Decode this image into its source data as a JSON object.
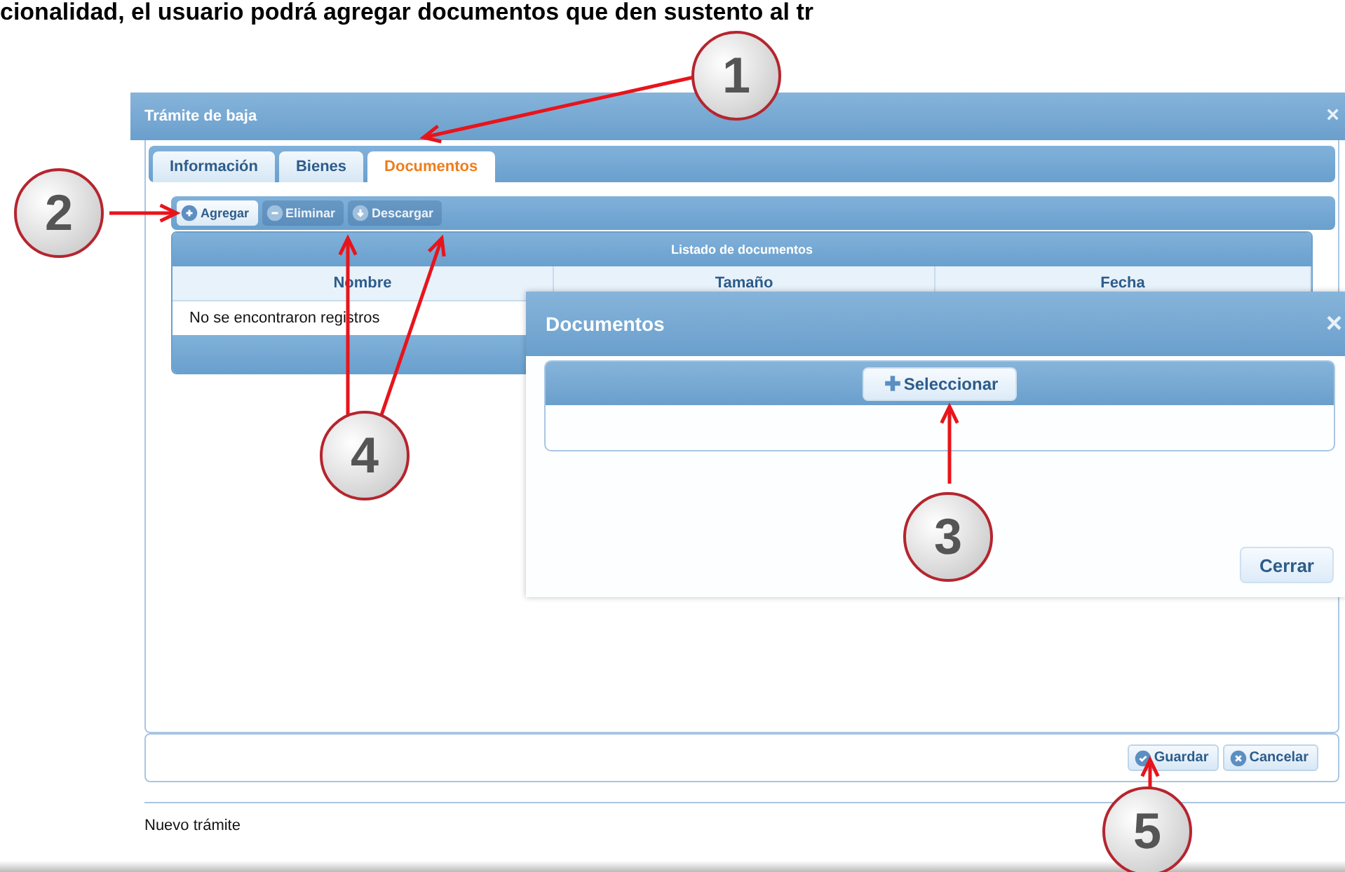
{
  "caption": "cionalidad, el usuario podrá agregar documentos que den sustento al tr",
  "window": {
    "title": "Trámite de baja",
    "close": "×",
    "tabs": [
      {
        "label": "Información",
        "selected": false
      },
      {
        "label": "Bienes",
        "selected": false
      },
      {
        "label": "Documentos",
        "selected": true
      }
    ],
    "toolbar": [
      {
        "label": "Agregar",
        "kind": "add",
        "disabled": false
      },
      {
        "label": "Eliminar",
        "kind": "remove",
        "disabled": true
      },
      {
        "label": "Descargar",
        "kind": "download",
        "disabled": true
      }
    ],
    "grid": {
      "title": "Listado de documentos",
      "columns": [
        "Nombre",
        "Tamaño",
        "Fecha"
      ],
      "empty_message": "No se encontraron registros"
    },
    "buttons": [
      {
        "label": "Guardar",
        "kind": "save"
      },
      {
        "label": "Cancelar",
        "kind": "cancel"
      }
    ]
  },
  "status_bar": "Nuevo trámite",
  "dialog": {
    "title": "Documentos",
    "close": "×",
    "select_button": "Seleccionar",
    "close_button": "Cerrar"
  },
  "callouts": [
    "1",
    "2",
    "3",
    "4",
    "5"
  ]
}
